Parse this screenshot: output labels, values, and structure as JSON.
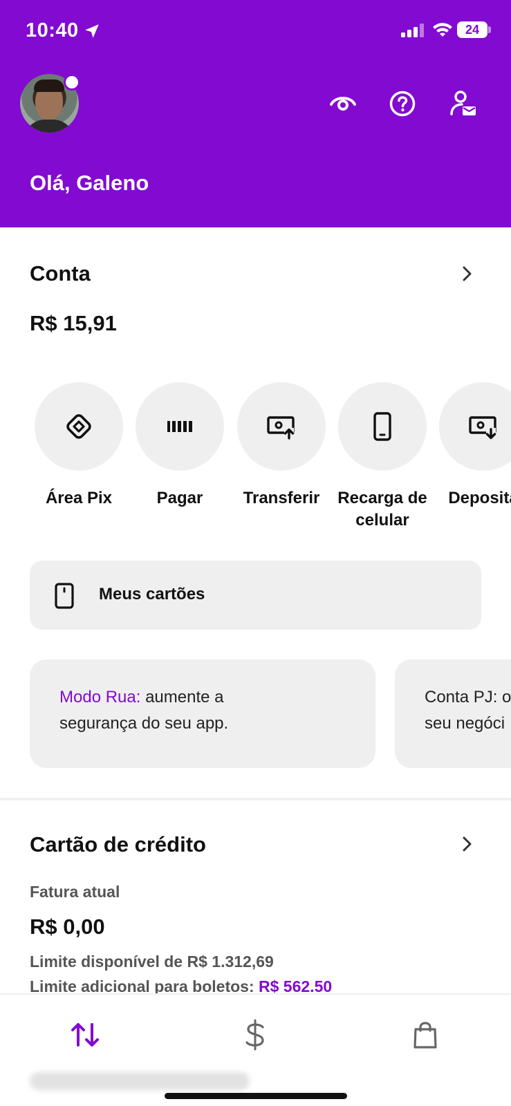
{
  "status_bar": {
    "time": "10:40",
    "battery": "24"
  },
  "header": {
    "greeting": "Olá, Galeno"
  },
  "account": {
    "title": "Conta",
    "balance": "R$ 15,91",
    "actions": [
      {
        "label": "Área Pix",
        "icon": "pix-icon"
      },
      {
        "label": "Pagar",
        "icon": "barcode-icon"
      },
      {
        "label": "Transferir",
        "icon": "transfer-icon"
      },
      {
        "label": "Recarga de celular",
        "icon": "phone-icon"
      },
      {
        "label": "Deposita",
        "icon": "deposit-icon"
      }
    ],
    "my_cards_label": "Meus cartões"
  },
  "promos": [
    {
      "highlight": "Modo Rua:",
      "text": " aumente a",
      "line2": "segurança do seu app."
    },
    {
      "highlight": "",
      "text": "Conta PJ: o",
      "line2": "seu negóci"
    }
  ],
  "credit_card": {
    "title": "Cartão de crédito",
    "invoice_label": "Fatura atual",
    "invoice_amount": "R$ 0,00",
    "available_limit": "Limite disponível de R$ 1.312,69",
    "boleto_limit_label": "Limite adicional para boletos: ",
    "boleto_limit_value": "R$ 562.50"
  },
  "colors": {
    "brand": "#820AD1",
    "surface": "#EFEFEF",
    "text": "#111111",
    "muted": "#555555"
  }
}
